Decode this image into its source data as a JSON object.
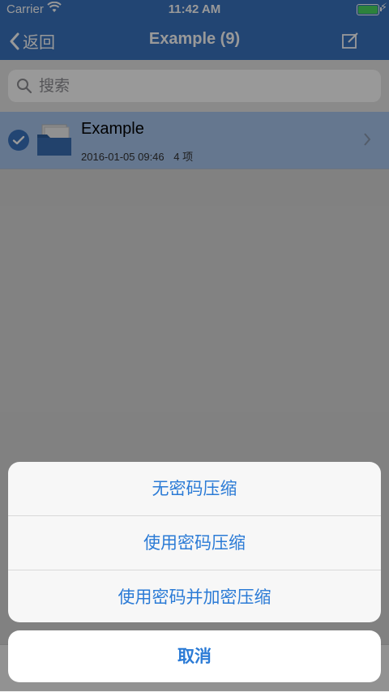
{
  "status": {
    "carrier": "Carrier",
    "time": "11:42 AM"
  },
  "nav": {
    "back_label": "返回",
    "title": "Example (9)"
  },
  "search": {
    "placeholder": "搜索"
  },
  "items": [
    {
      "name": "Example",
      "date": "2016-01-05 09:46",
      "count": "4 项",
      "selected": true
    }
  ],
  "actions": {
    "options": [
      "无密码压缩",
      "使用密码压缩",
      "使用密码并加密压缩"
    ],
    "cancel": "取消"
  },
  "colors": {
    "accent": "#3a73c0",
    "action_text": "#2b7bd6"
  }
}
